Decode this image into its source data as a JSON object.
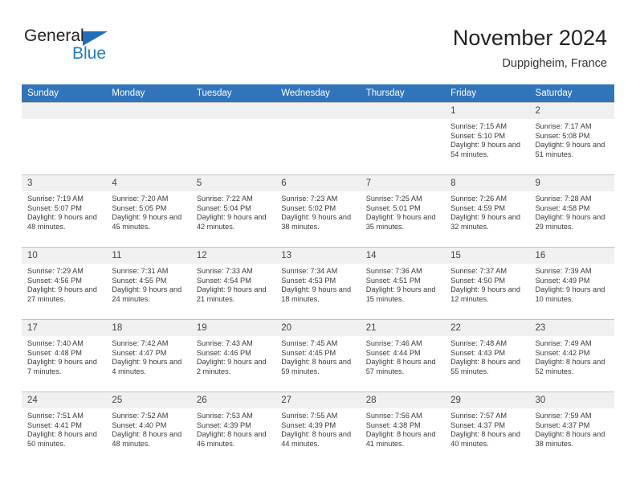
{
  "brand": {
    "name_part1": "General",
    "name_part2": "Blue",
    "triangle_icon": "triangle-icon",
    "accent_color": "#1f7ec4"
  },
  "header": {
    "title": "November 2024",
    "location": "Duppigheim, France"
  },
  "colors": {
    "header_row_bg": "#3075bc",
    "day_band_bg": "#f0f0f0",
    "grid_line": "#c3c3c3",
    "text": "#3a3a3a"
  },
  "calendar": {
    "weekday_headers": [
      "Sunday",
      "Monday",
      "Tuesday",
      "Wednesday",
      "Thursday",
      "Friday",
      "Saturday"
    ],
    "labels": {
      "sunrise": "Sunrise:",
      "sunset": "Sunset:",
      "daylight": "Daylight:"
    },
    "weeks": [
      [
        {
          "day": "",
          "empty": true
        },
        {
          "day": "",
          "empty": true
        },
        {
          "day": "",
          "empty": true
        },
        {
          "day": "",
          "empty": true
        },
        {
          "day": "",
          "empty": true
        },
        {
          "day": "1",
          "sunrise": "Sunrise: 7:15 AM",
          "sunset": "Sunset: 5:10 PM",
          "daylight": "Daylight: 9 hours and 54 minutes."
        },
        {
          "day": "2",
          "sunrise": "Sunrise: 7:17 AM",
          "sunset": "Sunset: 5:08 PM",
          "daylight": "Daylight: 9 hours and 51 minutes."
        }
      ],
      [
        {
          "day": "3",
          "sunrise": "Sunrise: 7:19 AM",
          "sunset": "Sunset: 5:07 PM",
          "daylight": "Daylight: 9 hours and 48 minutes."
        },
        {
          "day": "4",
          "sunrise": "Sunrise: 7:20 AM",
          "sunset": "Sunset: 5:05 PM",
          "daylight": "Daylight: 9 hours and 45 minutes."
        },
        {
          "day": "5",
          "sunrise": "Sunrise: 7:22 AM",
          "sunset": "Sunset: 5:04 PM",
          "daylight": "Daylight: 9 hours and 42 minutes."
        },
        {
          "day": "6",
          "sunrise": "Sunrise: 7:23 AM",
          "sunset": "Sunset: 5:02 PM",
          "daylight": "Daylight: 9 hours and 38 minutes."
        },
        {
          "day": "7",
          "sunrise": "Sunrise: 7:25 AM",
          "sunset": "Sunset: 5:01 PM",
          "daylight": "Daylight: 9 hours and 35 minutes."
        },
        {
          "day": "8",
          "sunrise": "Sunrise: 7:26 AM",
          "sunset": "Sunset: 4:59 PM",
          "daylight": "Daylight: 9 hours and 32 minutes."
        },
        {
          "day": "9",
          "sunrise": "Sunrise: 7:28 AM",
          "sunset": "Sunset: 4:58 PM",
          "daylight": "Daylight: 9 hours and 29 minutes."
        }
      ],
      [
        {
          "day": "10",
          "sunrise": "Sunrise: 7:29 AM",
          "sunset": "Sunset: 4:56 PM",
          "daylight": "Daylight: 9 hours and 27 minutes."
        },
        {
          "day": "11",
          "sunrise": "Sunrise: 7:31 AM",
          "sunset": "Sunset: 4:55 PM",
          "daylight": "Daylight: 9 hours and 24 minutes."
        },
        {
          "day": "12",
          "sunrise": "Sunrise: 7:33 AM",
          "sunset": "Sunset: 4:54 PM",
          "daylight": "Daylight: 9 hours and 21 minutes."
        },
        {
          "day": "13",
          "sunrise": "Sunrise: 7:34 AM",
          "sunset": "Sunset: 4:53 PM",
          "daylight": "Daylight: 9 hours and 18 minutes."
        },
        {
          "day": "14",
          "sunrise": "Sunrise: 7:36 AM",
          "sunset": "Sunset: 4:51 PM",
          "daylight": "Daylight: 9 hours and 15 minutes."
        },
        {
          "day": "15",
          "sunrise": "Sunrise: 7:37 AM",
          "sunset": "Sunset: 4:50 PM",
          "daylight": "Daylight: 9 hours and 12 minutes."
        },
        {
          "day": "16",
          "sunrise": "Sunrise: 7:39 AM",
          "sunset": "Sunset: 4:49 PM",
          "daylight": "Daylight: 9 hours and 10 minutes."
        }
      ],
      [
        {
          "day": "17",
          "sunrise": "Sunrise: 7:40 AM",
          "sunset": "Sunset: 4:48 PM",
          "daylight": "Daylight: 9 hours and 7 minutes."
        },
        {
          "day": "18",
          "sunrise": "Sunrise: 7:42 AM",
          "sunset": "Sunset: 4:47 PM",
          "daylight": "Daylight: 9 hours and 4 minutes."
        },
        {
          "day": "19",
          "sunrise": "Sunrise: 7:43 AM",
          "sunset": "Sunset: 4:46 PM",
          "daylight": "Daylight: 9 hours and 2 minutes."
        },
        {
          "day": "20",
          "sunrise": "Sunrise: 7:45 AM",
          "sunset": "Sunset: 4:45 PM",
          "daylight": "Daylight: 8 hours and 59 minutes."
        },
        {
          "day": "21",
          "sunrise": "Sunrise: 7:46 AM",
          "sunset": "Sunset: 4:44 PM",
          "daylight": "Daylight: 8 hours and 57 minutes."
        },
        {
          "day": "22",
          "sunrise": "Sunrise: 7:48 AM",
          "sunset": "Sunset: 4:43 PM",
          "daylight": "Daylight: 8 hours and 55 minutes."
        },
        {
          "day": "23",
          "sunrise": "Sunrise: 7:49 AM",
          "sunset": "Sunset: 4:42 PM",
          "daylight": "Daylight: 8 hours and 52 minutes."
        }
      ],
      [
        {
          "day": "24",
          "sunrise": "Sunrise: 7:51 AM",
          "sunset": "Sunset: 4:41 PM",
          "daylight": "Daylight: 8 hours and 50 minutes."
        },
        {
          "day": "25",
          "sunrise": "Sunrise: 7:52 AM",
          "sunset": "Sunset: 4:40 PM",
          "daylight": "Daylight: 8 hours and 48 minutes."
        },
        {
          "day": "26",
          "sunrise": "Sunrise: 7:53 AM",
          "sunset": "Sunset: 4:39 PM",
          "daylight": "Daylight: 8 hours and 46 minutes."
        },
        {
          "day": "27",
          "sunrise": "Sunrise: 7:55 AM",
          "sunset": "Sunset: 4:39 PM",
          "daylight": "Daylight: 8 hours and 44 minutes."
        },
        {
          "day": "28",
          "sunrise": "Sunrise: 7:56 AM",
          "sunset": "Sunset: 4:38 PM",
          "daylight": "Daylight: 8 hours and 41 minutes."
        },
        {
          "day": "29",
          "sunrise": "Sunrise: 7:57 AM",
          "sunset": "Sunset: 4:37 PM",
          "daylight": "Daylight: 8 hours and 40 minutes."
        },
        {
          "day": "30",
          "sunrise": "Sunrise: 7:59 AM",
          "sunset": "Sunset: 4:37 PM",
          "daylight": "Daylight: 8 hours and 38 minutes."
        }
      ]
    ]
  }
}
